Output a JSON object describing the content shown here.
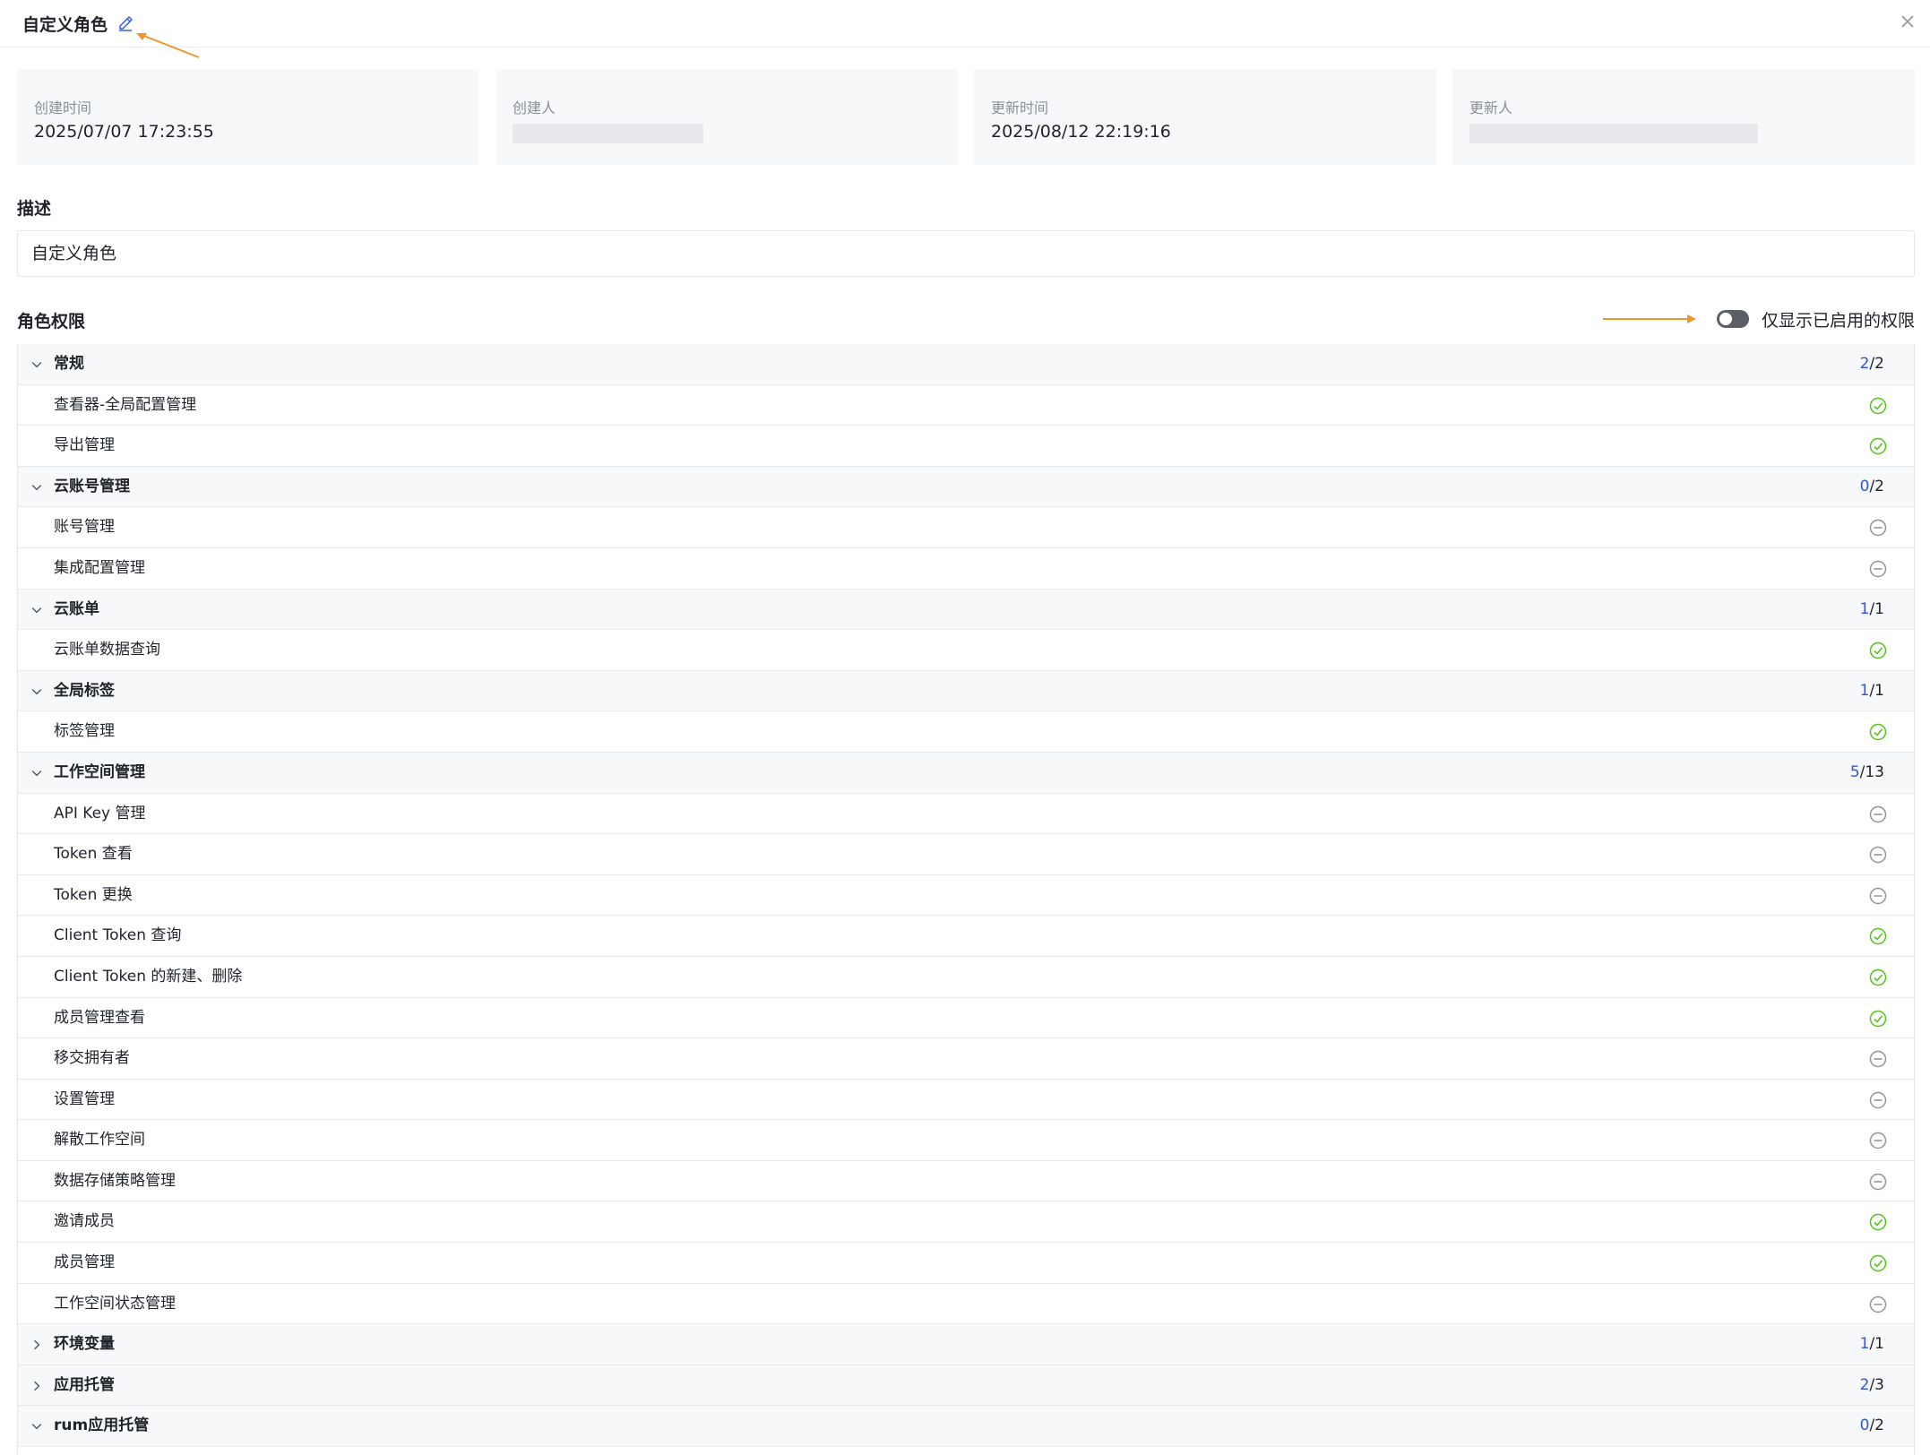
{
  "header": {
    "title": "自定义角色"
  },
  "info_cards": [
    {
      "label": "创建时间",
      "value": "2025/07/07 17:23:55"
    },
    {
      "label": "创建人",
      "value": ""
    },
    {
      "label": "更新时间",
      "value": "2025/08/12 22:19:16"
    },
    {
      "label": "更新人",
      "value": ""
    }
  ],
  "description": {
    "title": "描述",
    "value": "自定义角色"
  },
  "permissions": {
    "title": "角色权限",
    "toggle_label": "仅显示已启用的权限",
    "toggle_on": false,
    "groups": [
      {
        "name": "常规",
        "enabled": "2",
        "total": "/2",
        "expanded": true,
        "items": [
          {
            "name": "查看器-全局配置管理",
            "enabled": true
          },
          {
            "name": "导出管理",
            "enabled": true
          }
        ]
      },
      {
        "name": "云账号管理",
        "enabled": "0",
        "total": "/2",
        "expanded": true,
        "items": [
          {
            "name": "账号管理",
            "enabled": false
          },
          {
            "name": "集成配置管理",
            "enabled": false
          }
        ]
      },
      {
        "name": "云账单",
        "enabled": "1",
        "total": "/1",
        "expanded": true,
        "items": [
          {
            "name": "云账单数据查询",
            "enabled": true
          }
        ]
      },
      {
        "name": "全局标签",
        "enabled": "1",
        "total": "/1",
        "expanded": true,
        "items": [
          {
            "name": "标签管理",
            "enabled": true
          }
        ]
      },
      {
        "name": "工作空间管理",
        "enabled": "5",
        "total": "/13",
        "expanded": true,
        "items": [
          {
            "name": "API Key 管理",
            "enabled": false
          },
          {
            "name": "Token 查看",
            "enabled": false
          },
          {
            "name": "Token 更换",
            "enabled": false
          },
          {
            "name": "Client Token 查询",
            "enabled": true
          },
          {
            "name": "Client Token 的新建、删除",
            "enabled": true
          },
          {
            "name": "成员管理查看",
            "enabled": true
          },
          {
            "name": "移交拥有者",
            "enabled": false
          },
          {
            "name": "设置管理",
            "enabled": false
          },
          {
            "name": "解散工作空间",
            "enabled": false
          },
          {
            "name": "数据存储策略管理",
            "enabled": false
          },
          {
            "name": "邀请成员",
            "enabled": true
          },
          {
            "name": "成员管理",
            "enabled": true
          },
          {
            "name": "工作空间状态管理",
            "enabled": false
          }
        ]
      },
      {
        "name": "环境变量",
        "enabled": "1",
        "total": "/1",
        "expanded": false,
        "items": []
      },
      {
        "name": "应用托管",
        "enabled": "2",
        "total": "/3",
        "expanded": false,
        "items": []
      },
      {
        "name": "rum应用托管",
        "enabled": "0",
        "total": "/2",
        "expanded": true,
        "items": []
      }
    ]
  },
  "icons": {
    "edit": "pencil-icon",
    "close": "close-icon",
    "expanded": "chevron-down-icon",
    "collapsed": "chevron-right-icon",
    "enabled": "check-circle-icon",
    "disabled": "minus-circle-icon"
  },
  "colors": {
    "accent": "#2f54eb",
    "enabled": "#52c41a",
    "disabled": "#8f959e",
    "annotation_arrow": "#f0952b",
    "group_bg": "#f7f8fa"
  }
}
